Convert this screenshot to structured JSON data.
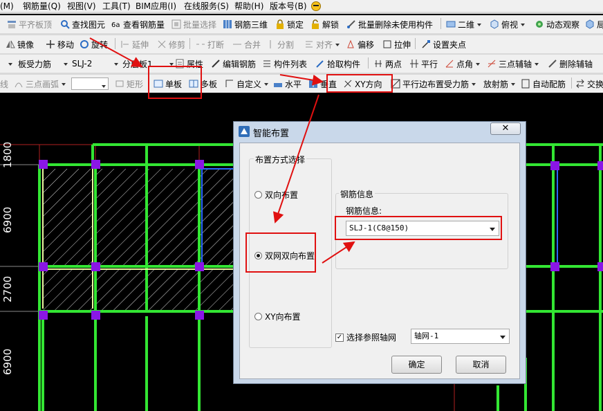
{
  "menubar": [
    "(M)",
    "钢筋量(Q)",
    "视图(V)",
    "工具(T)",
    "BIM应用(I)",
    "在线服务(S)",
    "帮助(H)",
    "版本号(B)"
  ],
  "toolbar1": {
    "items": [
      "平齐板顶",
      "查找图元",
      "查看钢筋量",
      "批量选择",
      "钢筋三维",
      "锁定",
      "解锁",
      "批量删除未使用构件",
      "二维",
      "俯视",
      "动态观察",
      "局"
    ]
  },
  "toolbar2": {
    "items": [
      "镜像",
      "移动",
      "旋转",
      "延伸",
      "修剪",
      "打断",
      "合并",
      "分割",
      "对齐",
      "偏移",
      "拉伸",
      "设置夹点"
    ]
  },
  "toolbar3": {
    "element_type": "板受力筋",
    "element_name": "SLJ-2",
    "layer": "分层板1",
    "items": [
      "属性",
      "编辑钢筋",
      "构件列表",
      "拾取构件",
      "两点",
      "平行",
      "点角",
      "三点辅轴",
      "删除辅轴"
    ]
  },
  "toolbar4": {
    "items": [
      "线",
      "三点画弧",
      "矩形",
      "单板",
      "多板",
      "自定义",
      "水平",
      "垂直",
      "XY方向",
      "平行边布置受力筋",
      "放射筋",
      "自动配筋",
      "交换"
    ]
  },
  "canvas": {
    "dimensions": [
      "1800",
      "6900",
      "2700",
      "6900"
    ]
  },
  "dialog": {
    "title": "智能布置",
    "close_label": "✕",
    "layout_group_title": "布置方式选择",
    "radio_options": [
      "双向布置",
      "双网双向布置",
      "XY向布置"
    ],
    "selected_option": "双网双向布置",
    "rebar_group_title": "钢筋信息",
    "rebar_field_label": "钢筋信息:",
    "rebar_value": "SLJ-1(C8@150)",
    "checkbox_label": "选择参照轴网",
    "checkbox_checked": true,
    "axis_value": "轴网-1",
    "ok_label": "确定",
    "cancel_label": "取消"
  },
  "colors": {
    "annotation_red": "#e01010",
    "grid_green": "#33e633",
    "selected_blue": "#2a6cff",
    "node_purple": "#8a16e6"
  }
}
